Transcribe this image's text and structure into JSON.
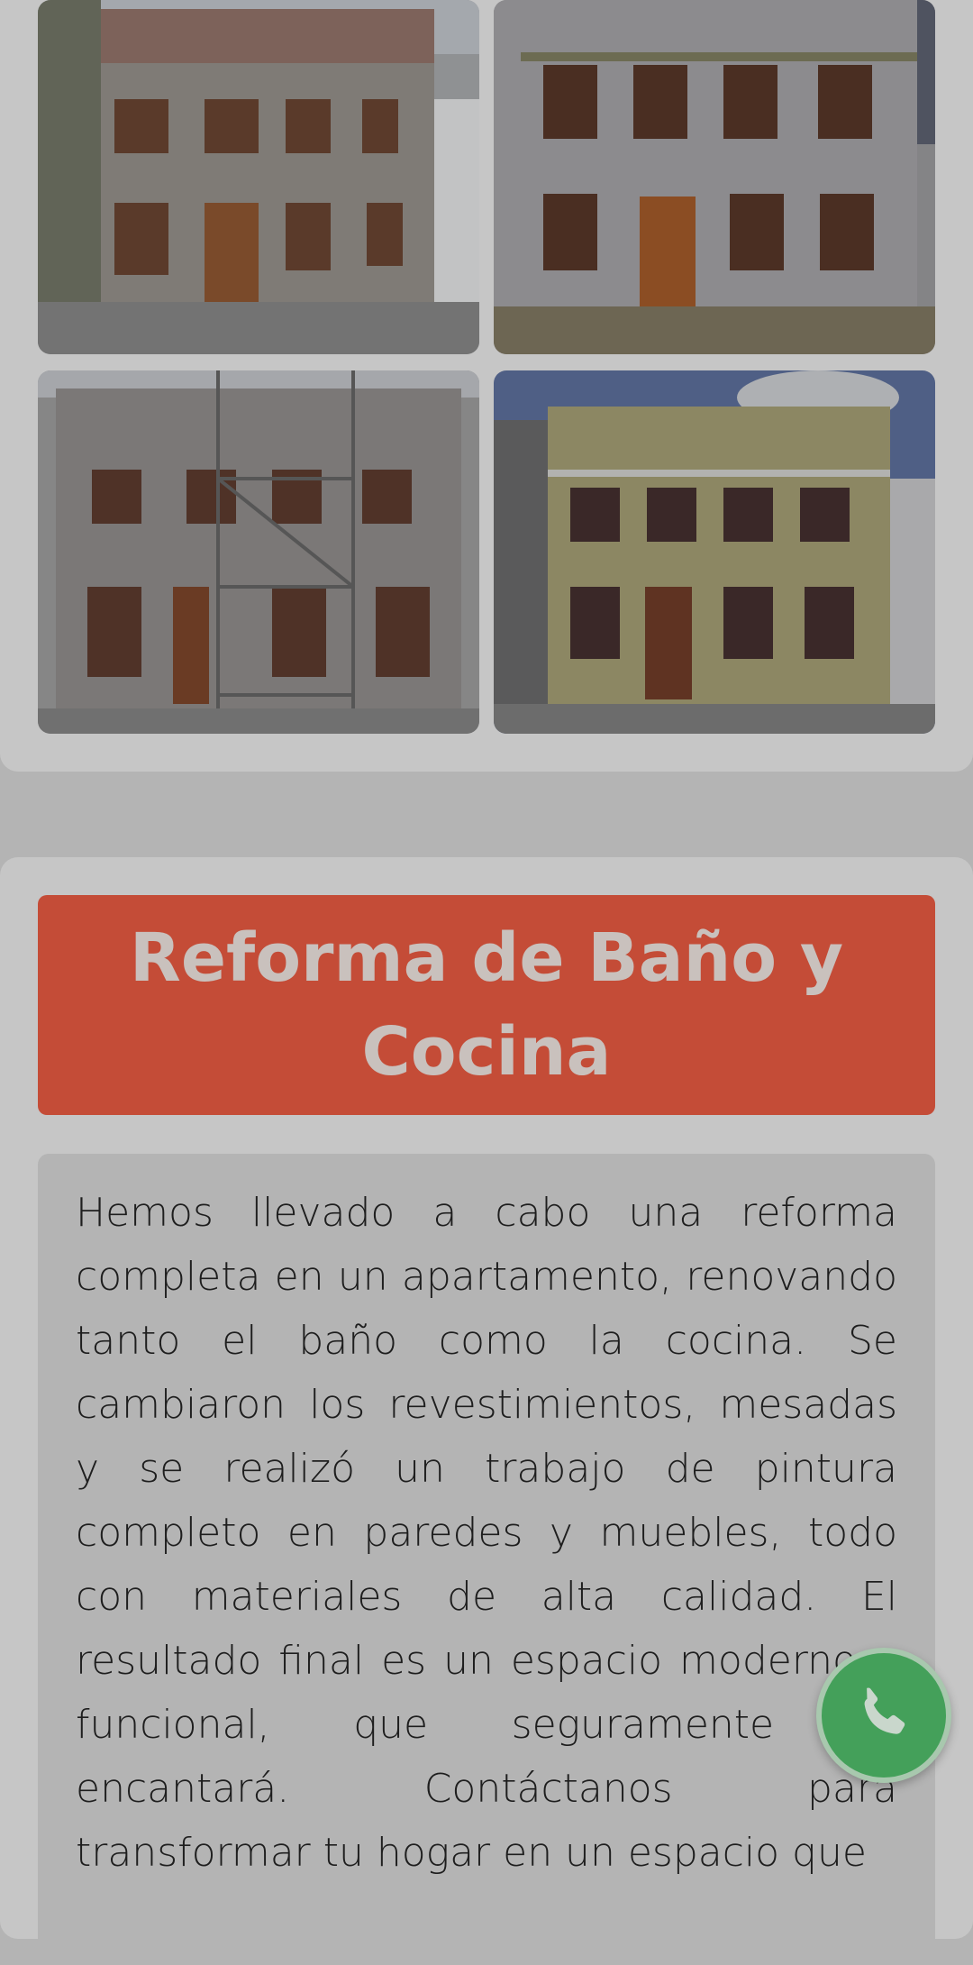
{
  "gallery": {
    "images": [
      {
        "alt": "Fachada antes de la reforma"
      },
      {
        "alt": "Fachada después de la reforma"
      },
      {
        "alt": "Fachada durante la obra con andamio"
      },
      {
        "alt": "Fachada terminada pintada"
      }
    ]
  },
  "project": {
    "title": "Reforma de Baño y Cocina",
    "description": "Hemos llevado a cabo una reforma completa en un apartamento, renovando tanto el baño como la cocina. Se cambiaron los revestimientos, mesadas y se realizó un trabajo de pintura completo en paredes y muebles, todo con materiales de alta calidad. El resultado final es un espacio moderno y funcional, que seguramente te encantará. Contáctanos para transformar tu hogar en un espacio que"
  },
  "whatsapp": {
    "icon": "whatsapp-icon",
    "color": "#44a05a"
  }
}
